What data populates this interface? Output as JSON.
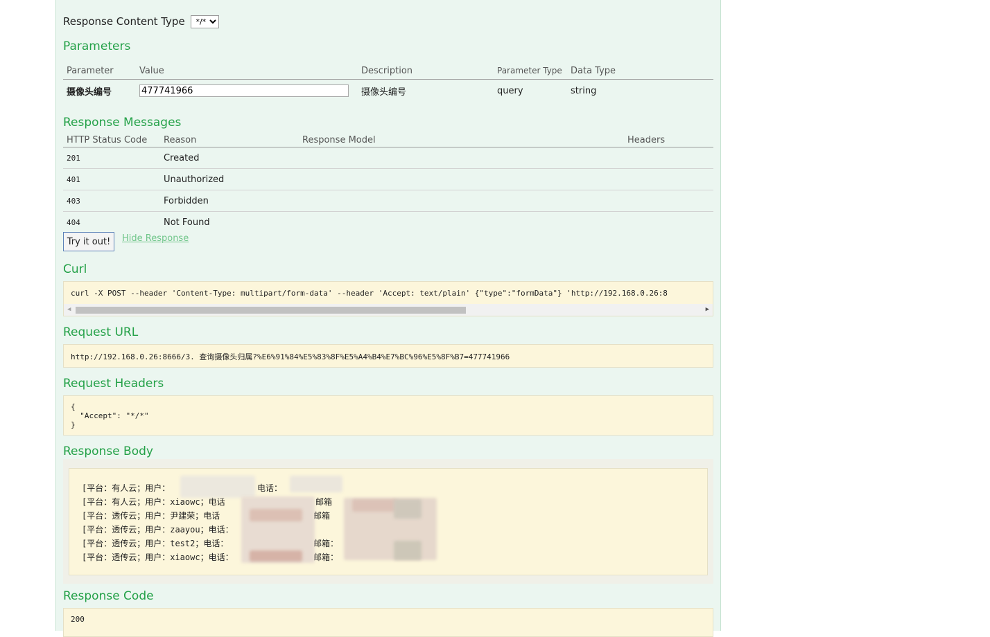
{
  "response_content_type": {
    "label": "Response Content Type",
    "value": "*/*"
  },
  "parameters": {
    "title": "Parameters",
    "headers": {
      "parameter": "Parameter",
      "value": "Value",
      "description": "Description",
      "param_type": "Parameter Type",
      "data_type": "Data Type"
    },
    "rows": [
      {
        "parameter": "摄像头编号",
        "value": "477741966",
        "description": "摄像头编号",
        "param_type": "query",
        "data_type": "string"
      }
    ]
  },
  "response_messages": {
    "title": "Response Messages",
    "headers": {
      "code": "HTTP Status Code",
      "reason": "Reason",
      "model": "Response Model",
      "headers": "Headers"
    },
    "rows": [
      {
        "code": "201",
        "reason": "Created"
      },
      {
        "code": "401",
        "reason": "Unauthorized"
      },
      {
        "code": "403",
        "reason": "Forbidden"
      },
      {
        "code": "404",
        "reason": "Not Found"
      }
    ]
  },
  "actions": {
    "try_label": "Try it out!",
    "hide_label": "Hide Response"
  },
  "curl": {
    "title": "Curl",
    "command": "curl -X POST --header 'Content-Type: multipart/form-data' --header 'Accept: text/plain' {\"type\":\"formData\"} 'http://192.168.0.26:8"
  },
  "request_url": {
    "title": "Request URL",
    "value": "http://192.168.0.26:8666/3. 查询摄像头归属?%E6%91%84%E5%83%8F%E5%A4%B4%E7%BC%96%E5%8F%B7=477741966"
  },
  "request_headers": {
    "title": "Request Headers",
    "line1": "{",
    "line2": "  \"Accept\": \"*/*\"",
    "line3": "}"
  },
  "response_body": {
    "title": "Response Body",
    "lines": [
      "[平台：有人云；用户：",
      "[平台：有人云；用户：xiaowc；电话",
      "[平台：透传云；用户：尹建荣；电话",
      "[平台：透传云；用户：zaayou；电话：",
      "[平台：透传云；用户：test2；电话：",
      "[平台：透传云；用户：xiaowc；电话："
    ],
    "fragments": {
      "phone": "电话：",
      "mail_1": "邮箱",
      "mail_2": "；邮箱",
      "mail_3": "邮箱：",
      "mail_4": "邮箱："
    }
  },
  "response_code": {
    "title": "Response Code",
    "value": "200"
  }
}
